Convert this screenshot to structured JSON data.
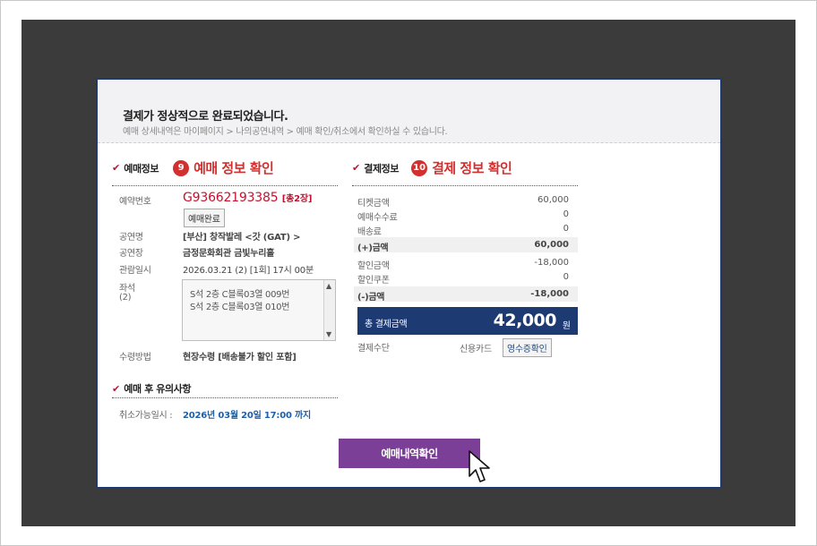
{
  "header": {
    "title": "결제가 정상적으로 완료되었습니다.",
    "subtitle": "예매 상세내역은 마이페이지 > 나의공연내역 > 예매 확인/취소에서 확인하실 수 있습니다."
  },
  "booking_section": {
    "title": "예매정보",
    "badge": "9",
    "annotation": "예매 정보 확인",
    "booking_no_label": "예약번호",
    "booking_no": "G93662193385",
    "ticket_count": "[총2장]",
    "status_button": "예매완료",
    "show_name_label": "공연명",
    "show_name": "[부산] 창작발레 <갓 (GAT) >",
    "venue_label": "공연장",
    "venue": "금정문화회관 금빛누리홀",
    "date_label": "관람일시",
    "date": "2026.03.21 (2) [1회] 17시 00분",
    "seat_label": "좌석",
    "seat_count": "(2)",
    "seats": [
      "S석 2층 C블록03열 009번",
      "S석 2층 C블록03열 010번"
    ],
    "pickup_label": "수령방법",
    "pickup": "현장수령 [배송불가 할인 포함]"
  },
  "notice_section": {
    "title": "예매 후 유의사항",
    "cancel_label": "취소가능일시 :",
    "cancel_date": "2026년 03월 20일 17:00 까지"
  },
  "payment_section": {
    "title": "결제정보",
    "badge": "10",
    "annotation": "결제 정보 확인",
    "rows": [
      {
        "label": "티켓금액",
        "value": "60,000"
      },
      {
        "label": "예매수수료",
        "value": "0"
      },
      {
        "label": "배송료",
        "value": "0"
      }
    ],
    "plus_label": "(+)금액",
    "plus_value": "60,000",
    "discount_rows": [
      {
        "label": "할인금액",
        "value": "-18,000"
      },
      {
        "label": "할인쿠폰",
        "value": "0"
      }
    ],
    "minus_label": "(-)금액",
    "minus_value": "-18,000",
    "total_label": "총 결제금액",
    "total_value": "42,000",
    "total_unit": "원",
    "method_label": "결제수단",
    "method_value": "신용카드",
    "receipt_button": "영수증확인"
  },
  "confirm_button": "예매내역확인",
  "colors": {
    "accent_red": "#d32f2f",
    "navy": "#1e3a73",
    "purple": "#7c3f98",
    "booking_red": "#c8102e",
    "notice_blue": "#1f5fa6"
  }
}
